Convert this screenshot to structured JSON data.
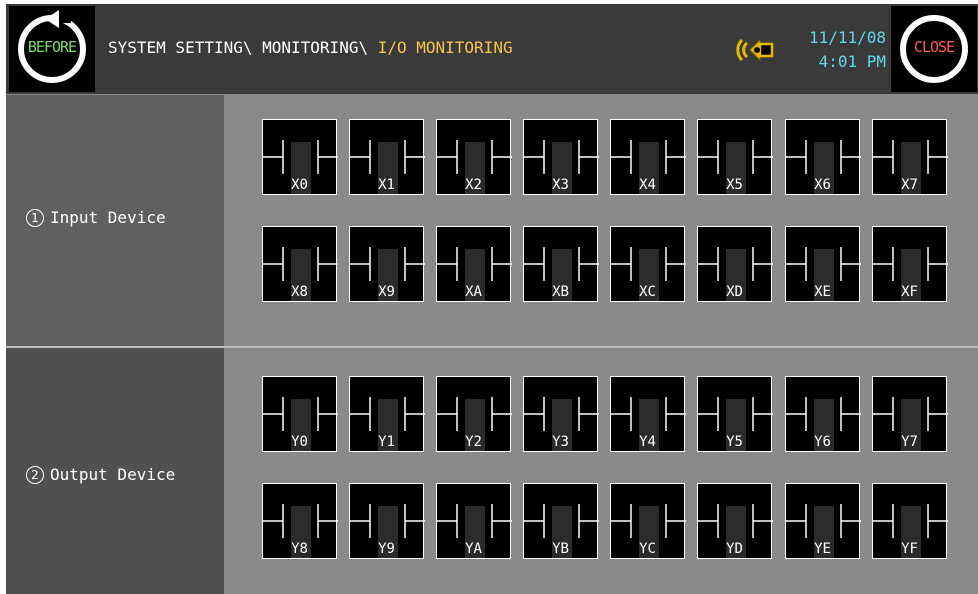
{
  "header": {
    "before_label": "BEFORE",
    "close_label": "CLOSE",
    "breadcrumb_path": "SYSTEM SETTING\\ MONITORING\\ ",
    "breadcrumb_current": "I/O MONITORING",
    "date": "11/11/08",
    "time": "4:01 PM",
    "sound_icon": "speaker-icon"
  },
  "input": {
    "number": "1",
    "title": "Input Device",
    "devices": [
      "X0",
      "X1",
      "X2",
      "X3",
      "X4",
      "X5",
      "X6",
      "X7",
      "X8",
      "X9",
      "XA",
      "XB",
      "XC",
      "XD",
      "XE",
      "XF"
    ]
  },
  "output": {
    "number": "2",
    "title": "Output Device",
    "devices": [
      "Y0",
      "Y1",
      "Y2",
      "Y3",
      "Y4",
      "Y5",
      "Y6",
      "Y7",
      "Y8",
      "Y9",
      "YA",
      "YB",
      "YC",
      "YD",
      "YE",
      "YF"
    ]
  },
  "colors": {
    "breadcrumb_current": "#f3c44b",
    "datetime": "#5fd7e6",
    "before": "#7fd96f",
    "close": "#ff5a5a"
  }
}
